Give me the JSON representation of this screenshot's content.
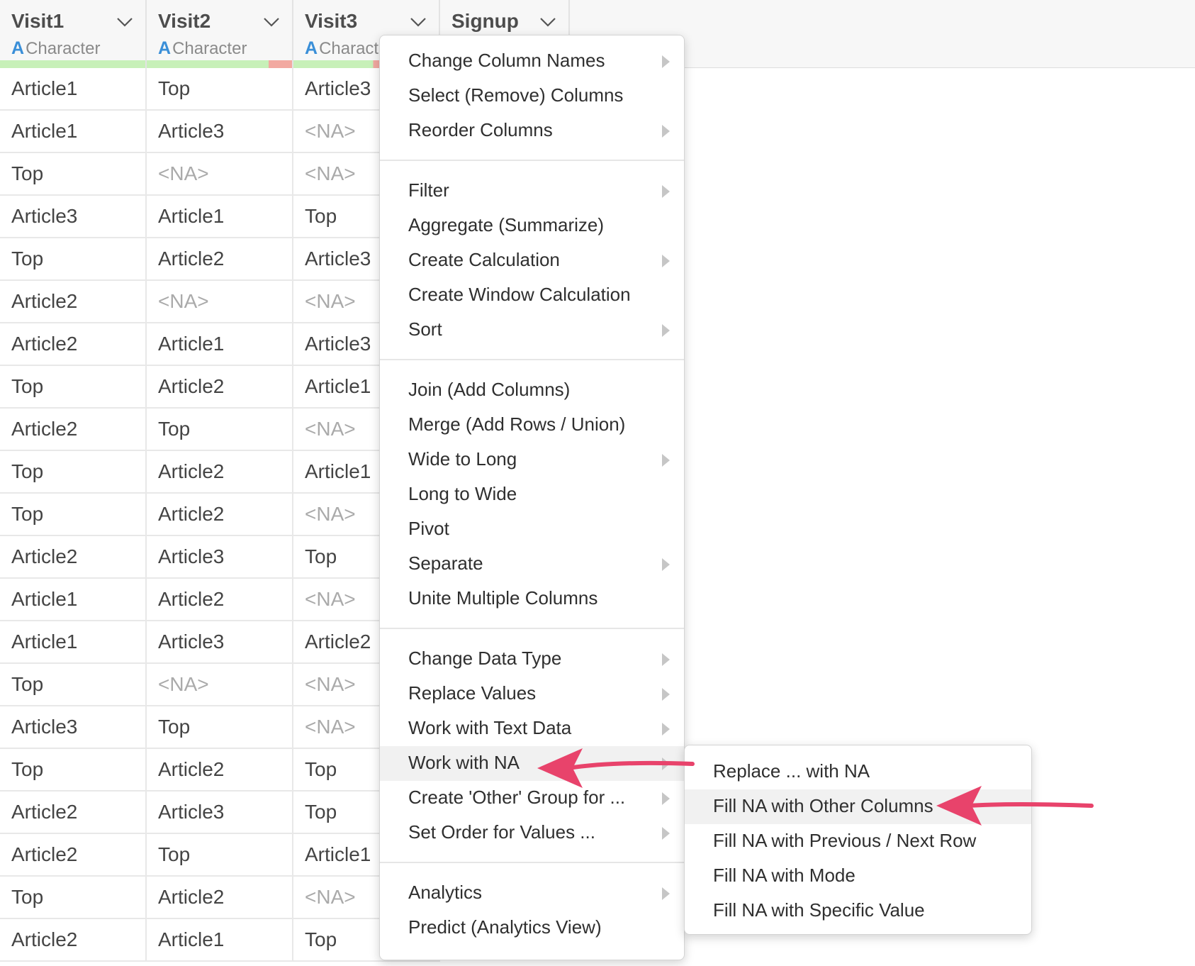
{
  "columns": [
    {
      "name": "Visit1",
      "type_icon": "A",
      "type_label": "Character"
    },
    {
      "name": "Visit2",
      "type_icon": "A",
      "type_label": "Character"
    },
    {
      "name": "Visit3",
      "type_icon": "A",
      "type_label": "Character"
    },
    {
      "name": "Signup",
      "type_icon": "",
      "type_label": ""
    }
  ],
  "quality_colors": {
    "valid": "#c7f0b8",
    "missing": "#f2a9a1"
  },
  "quality_fractions": [
    1.0,
    0.84,
    0.55
  ],
  "rows": [
    [
      "Article1",
      "Top",
      "Article3"
    ],
    [
      "Article1",
      "Article3",
      "<NA>"
    ],
    [
      "Top",
      "<NA>",
      "<NA>"
    ],
    [
      "Article3",
      "Article1",
      "Top"
    ],
    [
      "Top",
      "Article2",
      "Article3"
    ],
    [
      "Article2",
      "<NA>",
      "<NA>"
    ],
    [
      "Article2",
      "Article1",
      "Article3"
    ],
    [
      "Top",
      "Article2",
      "Article1"
    ],
    [
      "Article2",
      "Top",
      "<NA>"
    ],
    [
      "Top",
      "Article2",
      "Article1"
    ],
    [
      "Top",
      "Article2",
      "<NA>"
    ],
    [
      "Article2",
      "Article3",
      "Top"
    ],
    [
      "Article1",
      "Article2",
      "<NA>"
    ],
    [
      "Article1",
      "Article3",
      "Article2"
    ],
    [
      "Top",
      "<NA>",
      "<NA>"
    ],
    [
      "Article3",
      "Top",
      "<NA>"
    ],
    [
      "Top",
      "Article2",
      "Top"
    ],
    [
      "Article2",
      "Article3",
      "Top"
    ],
    [
      "Article2",
      "Top",
      "Article1"
    ],
    [
      "Top",
      "Article2",
      "<NA>"
    ],
    [
      "Article2",
      "Article1",
      "Top"
    ]
  ],
  "na_text": "<NA>",
  "menu": {
    "groups": [
      [
        {
          "label": "Change Column Names",
          "submenu": true
        },
        {
          "label": "Select (Remove) Columns",
          "submenu": false
        },
        {
          "label": "Reorder Columns",
          "submenu": true
        }
      ],
      [
        {
          "label": "Filter",
          "submenu": true
        },
        {
          "label": "Aggregate (Summarize)",
          "submenu": false
        },
        {
          "label": "Create Calculation",
          "submenu": true
        },
        {
          "label": "Create Window Calculation",
          "submenu": false
        },
        {
          "label": "Sort",
          "submenu": true
        }
      ],
      [
        {
          "label": "Join (Add Columns)",
          "submenu": false
        },
        {
          "label": "Merge (Add Rows / Union)",
          "submenu": false
        },
        {
          "label": "Wide to Long",
          "submenu": true
        },
        {
          "label": "Long to Wide",
          "submenu": false
        },
        {
          "label": "Pivot",
          "submenu": false
        },
        {
          "label": "Separate",
          "submenu": true
        },
        {
          "label": "Unite Multiple Columns",
          "submenu": false
        }
      ],
      [
        {
          "label": "Change Data Type",
          "submenu": true
        },
        {
          "label": "Replace Values",
          "submenu": true
        },
        {
          "label": "Work with Text Data",
          "submenu": true
        },
        {
          "label": "Work with NA",
          "submenu": true,
          "highlighted": true
        },
        {
          "label": "Create 'Other' Group for ...",
          "submenu": true
        },
        {
          "label": "Set Order for Values ...",
          "submenu": true
        }
      ],
      [
        {
          "label": "Analytics",
          "submenu": true
        },
        {
          "label": "Predict (Analytics View)",
          "submenu": false
        }
      ]
    ]
  },
  "submenu": {
    "items": [
      {
        "label": "Replace ... with NA"
      },
      {
        "label": "Fill NA with Other Columns",
        "highlighted": true
      },
      {
        "label": "Fill NA with Previous / Next Row"
      },
      {
        "label": "Fill NA with Mode"
      },
      {
        "label": "Fill NA with Specific Value"
      }
    ]
  },
  "annotation_color": "#e8436b"
}
